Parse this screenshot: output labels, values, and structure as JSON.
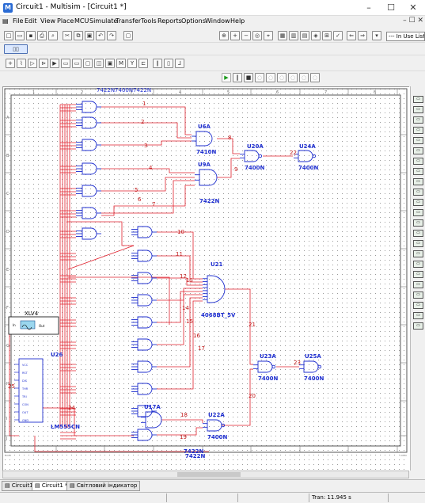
{
  "window": {
    "title": "Circuit1 - Multisim - [Circuit1 *]",
    "app_icon": "multisim-icon",
    "minimize": "–",
    "maximize": "☐",
    "close": "✕"
  },
  "menu": [
    "File",
    "Edit",
    "View",
    "Place",
    "MCU",
    "Simulate",
    "Transfer",
    "Tools",
    "Reports",
    "Options",
    "Window",
    "Help"
  ],
  "toolbar": {
    "in_use_list": "--- In Use List ---"
  },
  "circuit": {
    "col_numbers": [
      "1",
      "2",
      "3",
      "4",
      "5",
      "6",
      "7",
      "8"
    ],
    "row_letters": [
      "A",
      "B",
      "C",
      "D",
      "E",
      "F",
      "G",
      "H",
      "I",
      "J"
    ],
    "instruments": {
      "xlv4_label": "XLV4",
      "xlv4_in": "In",
      "xlv4_out": "Out"
    },
    "ic": {
      "name": "U26",
      "part": "LM555CN",
      "pins": [
        "VCC",
        "RST",
        "DIS",
        "THR",
        "TRI",
        "CON",
        "OUT",
        "GND"
      ]
    },
    "components": [
      {
        "ref": "U6A",
        "part": "7410N"
      },
      {
        "ref": "U9A",
        "part": "7422N"
      },
      {
        "ref": "U20A",
        "part": "7400N"
      },
      {
        "ref": "U24A",
        "part": "7400N"
      },
      {
        "ref": "U21",
        "part": "4068BT_5V"
      },
      {
        "ref": "U23A",
        "part": "7400N"
      },
      {
        "ref": "U25A",
        "part": "7400N"
      },
      {
        "ref": "U17A",
        "part": "7422N"
      },
      {
        "ref": "U22A",
        "part": "7400N"
      }
    ],
    "top_overlap_text": "7422N7400N7422N",
    "bottom_overlap_text": "7422N",
    "bottom_overlap_text2": "7422N",
    "net_labels": [
      "1",
      "2",
      "3",
      "4",
      "5",
      "6",
      "7",
      "8",
      "9",
      "10",
      "11",
      "12",
      "13",
      "14",
      "15",
      "16",
      "17",
      "18",
      "19",
      "20",
      "21",
      "22",
      "23",
      "24",
      "25"
    ]
  },
  "sheet_tabs": [
    "Circuit1",
    "Circuit1 *",
    "Світловий індикатор"
  ],
  "status": {
    "tran": "Tran: 11.945 s"
  }
}
